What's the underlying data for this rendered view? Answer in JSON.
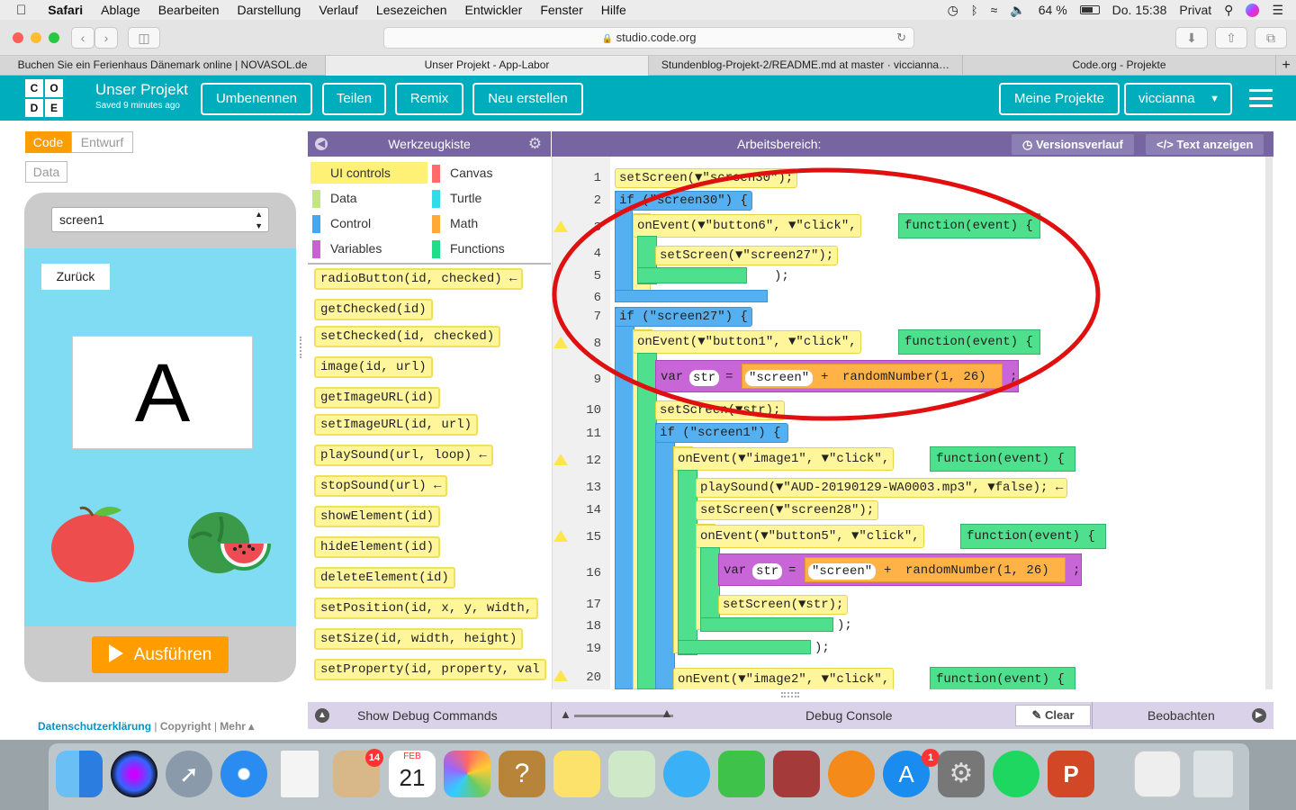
{
  "menubar": {
    "app": "Safari",
    "items": [
      "Ablage",
      "Bearbeiten",
      "Darstellung",
      "Verlauf",
      "Lesezeichen",
      "Entwickler",
      "Fenster",
      "Hilfe"
    ],
    "battery": "64 %",
    "clock": "Do. 15:38",
    "user": "Privat"
  },
  "browser": {
    "url": "studio.code.org",
    "tabs": [
      "Buchen Sie ein Ferienhaus Dänemark online | NOVASOL.de",
      "Unser Projekt - App-Labor",
      "Stundenblog-Projekt-2/README.md at master · viccianna…",
      "Code.org - Projekte"
    ]
  },
  "header": {
    "title": "Unser Projekt",
    "saved": "Saved 9 minutes ago",
    "rename": "Umbenennen",
    "share": "Teilen",
    "remix": "Remix",
    "new": "Neu erstellen",
    "my_projects": "Meine Projekte",
    "user": "viccianna"
  },
  "left": {
    "mode_code": "Code",
    "mode_design": "Entwurf",
    "data_btn": "Data",
    "screen_select": "screen1",
    "back_button": "Zurück",
    "letter": "A",
    "run": "Ausführen",
    "footer": {
      "privacy": "Datenschutzerklärung",
      "copyright": "Copyright",
      "more": "Mehr ▴"
    }
  },
  "toolbox": {
    "title": "Werkzeugkiste",
    "categories": [
      {
        "label": "UI controls",
        "color": "#fff176"
      },
      {
        "label": "Canvas",
        "color": "#ff6b6b"
      },
      {
        "label": "Data",
        "color": "#c3e77c"
      },
      {
        "label": "Turtle",
        "color": "#33dbe8"
      },
      {
        "label": "Control",
        "color": "#45a7f2"
      },
      {
        "label": "Math",
        "color": "#ffa938"
      },
      {
        "label": "Variables",
        "color": "#cd5fd6"
      },
      {
        "label": "Functions",
        "color": "#22dd88"
      }
    ],
    "blocks": [
      "radioButton(id, checked) ←",
      "getChecked(id)",
      "setChecked(id, checked)",
      "image(id, url)",
      "getImageURL(id)",
      "setImageURL(id, url)",
      "playSound(url, loop) ←",
      "stopSound(url) ←",
      "showElement(id)",
      "hideElement(id)",
      "deleteElement(id)",
      "setPosition(id, x, y, width,",
      "setSize(id, width, height)",
      "setProperty(id, property, val"
    ]
  },
  "workspace": {
    "title": "Arbeitsbereich:",
    "history": "Versionsverlauf",
    "show_text": "Text anzeigen",
    "line_numbers": [
      "1",
      "2",
      "3",
      "4",
      "5",
      "6",
      "7",
      "8",
      "9",
      "10",
      "11",
      "12",
      "13",
      "14",
      "15",
      "16",
      "17",
      "18",
      "19",
      "20"
    ]
  },
  "code": {
    "l1": "setScreen(▼\"screen30\");",
    "l2": "if (\"screen30\") {",
    "l3a": "onEvent(▼\"button6\", ▼\"click\",",
    "l3b": "function(event) {",
    "l4": "setScreen(▼\"screen27\");",
    "l5": ");",
    "l7": "if (\"screen27\") {",
    "l8a": "onEvent(▼\"button1\", ▼\"click\",",
    "l8b": "function(event) {",
    "l9a": "var",
    "l9b": "str",
    "l9c": "=",
    "l9d": "\"screen\"",
    "l9e": "+",
    "l9f": "randomNumber(1, 26)",
    "l9g": ";",
    "l10": "setScreen(▼str);",
    "l11": "if (\"screen1\") {",
    "l12a": "onEvent(▼\"image1\", ▼\"click\",",
    "l12b": "function(event) {",
    "l13": "playSound(▼\"AUD-20190129-WA0003.mp3\", ▼false); ←",
    "l14": "setScreen(▼\"screen28\");",
    "l15a": "onEvent(▼\"button5\", ▼\"click\",",
    "l15b": "function(event) {",
    "l16a": "var",
    "l16b": "str",
    "l16c": "=",
    "l16d": "\"screen\"",
    "l16e": "+",
    "l16f": "randomNumber(1, 26)",
    "l16g": ";",
    "l17": "setScreen(▼str);",
    "l18": ");",
    "l19": ");",
    "l20a": "onEvent(▼\"image2\", ▼\"click\",",
    "l20b": "function(event) {"
  },
  "bottom": {
    "debug_commands": "Show Debug Commands",
    "debug_console": "Debug Console",
    "clear": "Clear",
    "watch": "Beobachten"
  },
  "dock": {
    "mail_badge": "14",
    "appstore_badge": "1",
    "calendar_month": "FEB",
    "calendar_day": "21"
  }
}
